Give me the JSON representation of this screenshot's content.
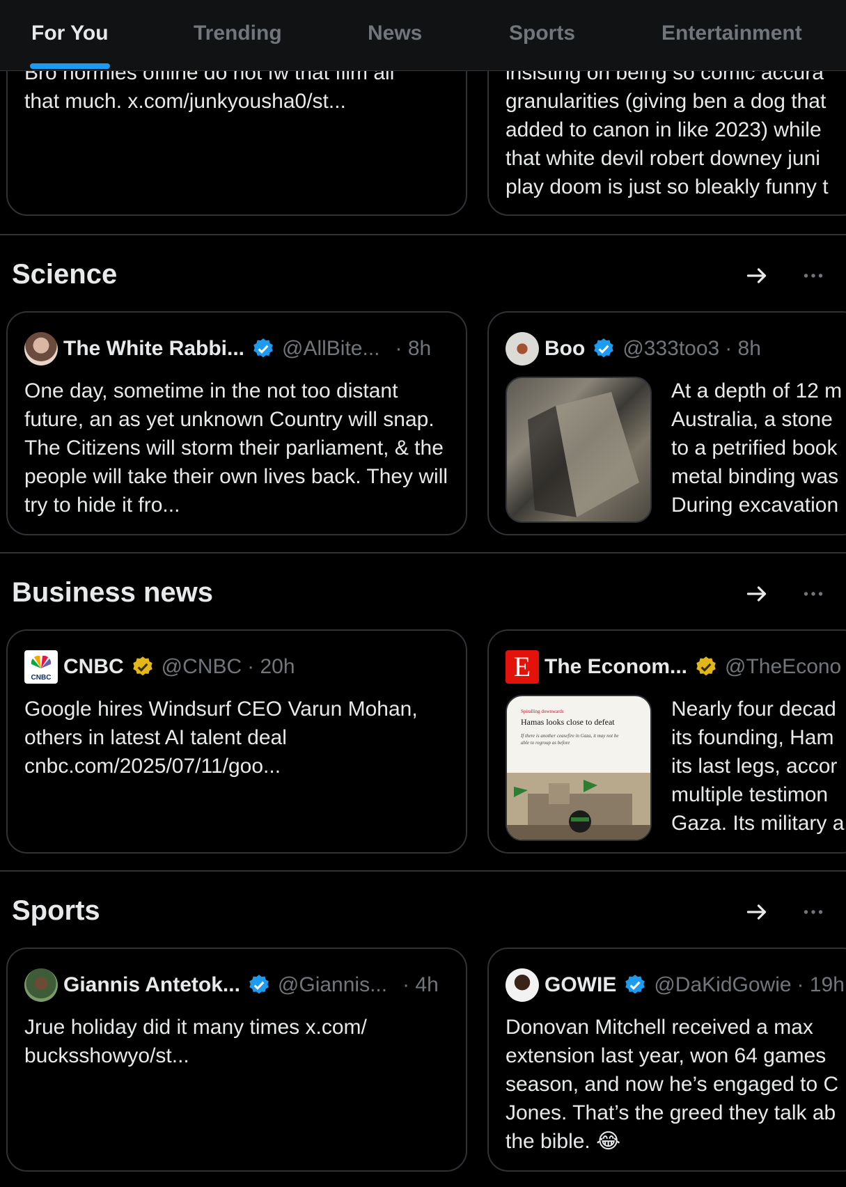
{
  "tabs": [
    {
      "label": "For You",
      "active": true
    },
    {
      "label": "Trending",
      "active": false
    },
    {
      "label": "News",
      "active": false
    },
    {
      "label": "Sports",
      "active": false
    },
    {
      "label": "Entertainment",
      "active": false
    }
  ],
  "colors": {
    "accent": "#1d9bf0",
    "verified_blue": "#1d9bf0",
    "verified_gold": "#e2b719",
    "muted": "#71767b"
  },
  "top_partial": {
    "left_text_line1": "Bro normies offline do not fw that film all",
    "left_text_line2": "that much. x.com/junkyousha0/st...",
    "right_lines": [
      "insisting on being so comic accura",
      "granularities (giving ben a dog that",
      "added to canon in like 2023) while",
      "that white devil robert downey juni",
      "play doom is just so bleakly funny t"
    ]
  },
  "sections": [
    {
      "title": "Science",
      "arrow_icon": "arrow-right-icon",
      "more_icon": "more-horizontal-icon",
      "left": {
        "name": "The White Rabbi...",
        "handle": "@AllBite...",
        "time": "· 8h",
        "verified": "blue",
        "text": "One day, sometime in the not too distant future, an as yet unknown Country will snap. The Citizens will storm their parliament, & the people will take their own lives back. They will try to hide it fro..."
      },
      "right": {
        "name": "Boo",
        "handle": "@333too3",
        "time": "· 8h",
        "verified": "blue",
        "lines": [
          "At a depth of 12 m",
          "Australia, a stone",
          "to a petrified book",
          "metal binding was",
          "During excavation"
        ]
      }
    },
    {
      "title": "Business news",
      "arrow_icon": "arrow-right-icon",
      "more_icon": "more-horizontal-icon",
      "left": {
        "name": "CNBC",
        "handle": "@CNBC",
        "time": "· 20h",
        "verified": "gold",
        "text_line1": "Google hires Windsurf CEO Varun Mohan,",
        "text_line2": "others in latest AI talent deal",
        "text_line3": "cnbc.com/2025/07/11/goo..."
      },
      "right": {
        "name": "The Econom...",
        "handle": "@TheEcono",
        "time": "",
        "verified": "gold",
        "logo_letter": "E",
        "thumb_kicker": "Spiralling downwards",
        "thumb_headline": "Hamas looks close to defeat",
        "thumb_sub": "If there is another ceasefire in Gaza, it may not be able to regroup as before",
        "lines": [
          "Nearly four decad",
          "its founding, Ham",
          "its last legs, accor",
          "multiple testimon",
          "Gaza. Its military a"
        ]
      }
    },
    {
      "title": "Sports",
      "arrow_icon": "arrow-right-icon",
      "more_icon": "more-horizontal-icon",
      "left": {
        "name": "Giannis Antetok...",
        "handle": "@Giannis...",
        "time": "· 4h",
        "verified": "blue",
        "text_line1": "Jrue holiday did it many times x.com/",
        "text_line2": "bucksshowyo/st..."
      },
      "right": {
        "name": "GOWIE",
        "handle": "@DaKidGowie",
        "time": "· 19h",
        "verified": "blue",
        "lines": [
          "Donovan Mitchell received a max",
          "extension last year, won 64 games",
          "season, and now he’s engaged to C",
          "Jones. That’s the greed they talk ab",
          "the bible. 😂"
        ]
      }
    }
  ]
}
